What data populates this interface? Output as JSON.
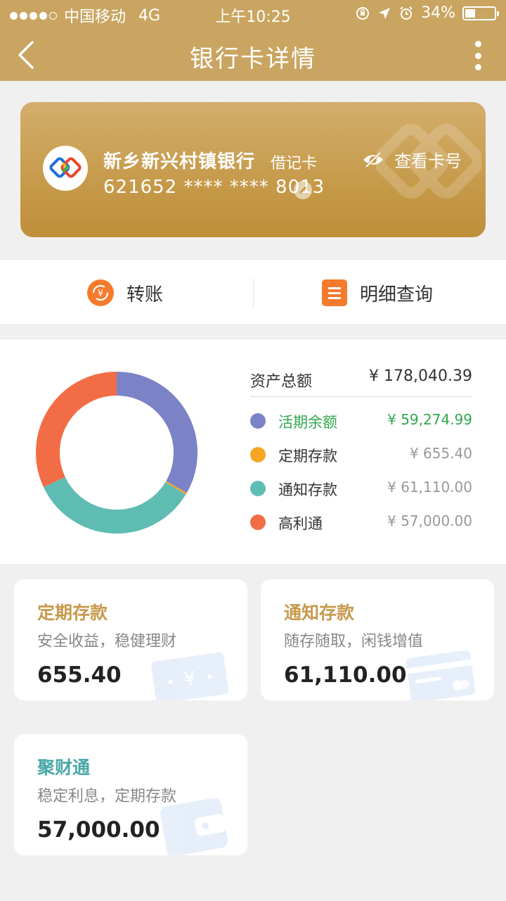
{
  "status_bar": {
    "carrier": "中国移动",
    "network": "4G",
    "time": "上午10:25",
    "battery": "34%",
    "battery_level": 0.34
  },
  "navbar": {
    "title": "银行卡详情"
  },
  "card": {
    "bank_name": "新乡新兴村镇银行",
    "card_type": "借记卡",
    "number": "621652 **** **** 8013",
    "view_label": "查看卡号"
  },
  "actions": {
    "transfer": "转账",
    "detail": "明细查询"
  },
  "assets": {
    "total_label": "资产总额",
    "total_value": "¥ 178,040.39",
    "items": [
      {
        "label": "活期余额",
        "value": "¥ 59,274.99",
        "amount": 59274.99,
        "color": "#7b83c6"
      },
      {
        "label": "定期存款",
        "value": "¥ 655.40",
        "amount": 655.4,
        "color": "#f5a623"
      },
      {
        "label": "通知存款",
        "value": "¥ 61,110.00",
        "amount": 61110.0,
        "color": "#5fbcb3"
      },
      {
        "label": "高利通",
        "value": "¥ 57,000.00",
        "amount": 57000.0,
        "color": "#f26d45"
      }
    ]
  },
  "products": [
    {
      "name": "定期存款",
      "desc": "安全收益，稳健理财",
      "amount": "655.40"
    },
    {
      "name": "通知存款",
      "desc": "随存随取，闲钱增值",
      "amount": "61,110.00"
    },
    {
      "name": "聚财通",
      "desc": "稳定利息，定期存款",
      "amount": "57,000.00"
    }
  ]
}
